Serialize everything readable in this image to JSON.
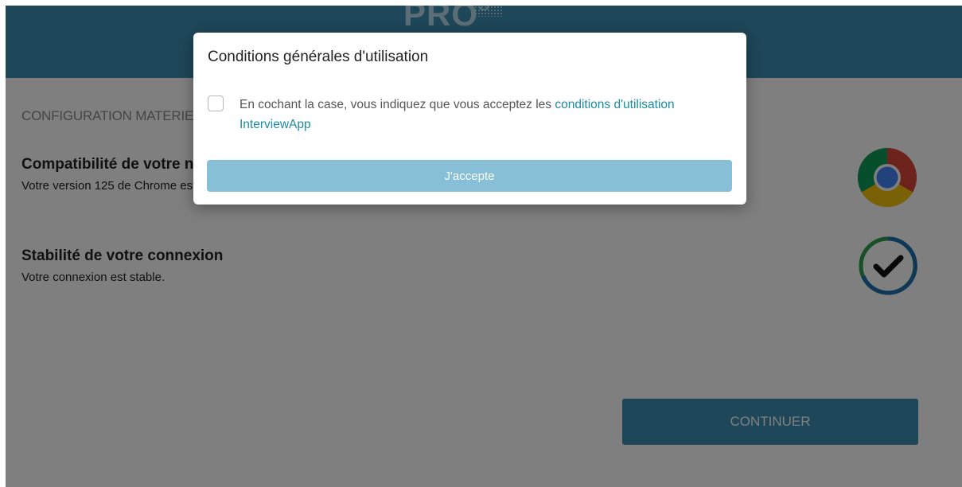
{
  "header": {
    "logo_text": "PRO",
    "logo_superscript": "3"
  },
  "page": {
    "section_title": "CONFIGURATION MATERIELLE",
    "items": [
      {
        "title": "Compatibilité de votre navigateur",
        "subtitle": "Votre version 125 de Chrome est compatible.",
        "icon": "chrome-icon"
      },
      {
        "title": "Stabilité de votre connexion",
        "subtitle": "Votre connexion est stable.",
        "icon": "check-circle-icon"
      }
    ],
    "continue_label": "CONTINUER"
  },
  "modal": {
    "title": "Conditions générales d'utilisation",
    "consent_text": "En cochant la case, vous indiquez que vous acceptez les ",
    "consent_link": "conditions d'utilisation InterviewApp",
    "checkbox_checked": false,
    "accept_label": "J'accepte"
  },
  "colors": {
    "brand": "#3c8fb2",
    "link": "#1d8ba0",
    "accept_disabled": "#86bfd6",
    "check_ring_blue": "#1f6fb0",
    "check_ring_green": "#2e9e4f"
  }
}
